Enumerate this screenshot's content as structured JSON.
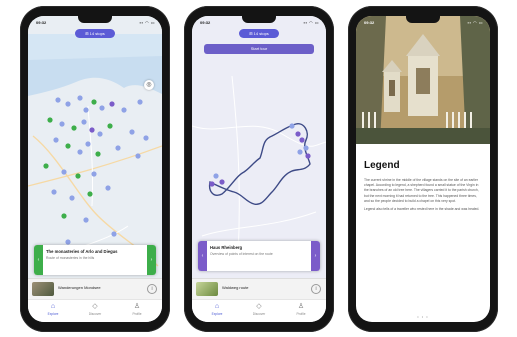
{
  "colors": {
    "accent": "#5b5bd6",
    "green": "#3dae4a",
    "purple": "#7b5cc9",
    "marker_blue": "#8fa2e6",
    "route": "#3d4a86"
  },
  "phone1": {
    "status_time": "09:32",
    "status_icons": "▪▪ ◠ ▭",
    "pill": "⊞ 14 stops",
    "locate_icon": "◎",
    "card": {
      "title": "The monasteries of Arlo and Diegus",
      "sub": "Route of monasteries in the hills",
      "bar_icon": "‹",
      "go_icon": "›"
    },
    "tour": {
      "name": "Wanderungen Mondsee"
    },
    "nav": [
      {
        "icon": "⌂",
        "label": "Explore"
      },
      {
        "icon": "◇",
        "label": "Discover"
      },
      {
        "icon": "♙",
        "label": "Profile"
      }
    ]
  },
  "phone2": {
    "status_time": "09:32",
    "status_icons": "▪▪ ◠ ▭",
    "pill": "⊞ 14 stops",
    "route_button": "Start tour",
    "card": {
      "title": "Haus Rheinberg",
      "sub": "Overview of points of interest on the route",
      "bar_icon": "‹",
      "go_icon": "›"
    },
    "tour": {
      "name": "Waldweg route"
    },
    "nav": [
      {
        "icon": "⌂",
        "label": "Explore"
      },
      {
        "icon": "◇",
        "label": "Discover"
      },
      {
        "icon": "♙",
        "label": "Profile"
      }
    ]
  },
  "phone3": {
    "status_time": "09:32",
    "status_icons": "▪▪ ◠ ▭",
    "heading": "Legend",
    "para1": "The current shrine in the middle of the village stands on the site of an earlier chapel. According to legend, a shepherd found a small statue of the Virgin in the branches of an old tree here. The villagers carried it to the parish church, but the next morning it had returned to the tree. This happened three times, and so the people decided to build a chapel on this very spot.",
    "para2": "Legend also tells of a traveller who rested here in the shade and was healed.",
    "page_dots": "• • •"
  }
}
